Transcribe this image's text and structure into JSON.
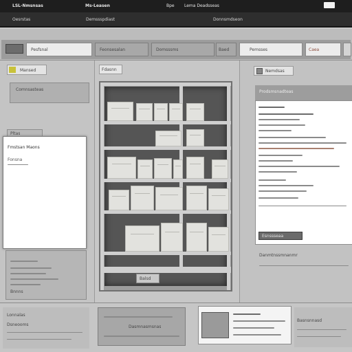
{
  "titlebar": {
    "text_1": "LSL-Nmsnsas",
    "text_2": "Ms-Leasen",
    "text_3": "Bpe",
    "text_4": "Lema Deadsseas"
  },
  "menubar": {
    "items": [
      "Oesrstas",
      "Demssspdiast",
      "Donnsmdseon"
    ]
  },
  "toolbar": {
    "tabs": [
      "Pesfsnal",
      "Feonsesalan",
      "Domsssms",
      "Baed",
      "Pemsses",
      "Caea"
    ]
  },
  "left_panel": {
    "tab": "Mansed",
    "header": "Comnsasteas",
    "card_tab": "Pltas",
    "card_title": "Fmstsan Maons",
    "card_sub": "Fonsna",
    "footer": "Bnnns"
  },
  "center_panel": {
    "tab": "Fdasnn",
    "status": "Balsd"
  },
  "right_panel": {
    "tab": "Nemdsas",
    "header": "Prodsmsnadteas",
    "action": "Esnssseaa",
    "footer": "Danmtnssmnanmr"
  },
  "bottom_panel": {
    "left_title": "Lonnalas",
    "left_sub": "Dsneooms",
    "mid_label": "Dasmnasmsnas",
    "right_title": "Basnsnnasd"
  }
}
